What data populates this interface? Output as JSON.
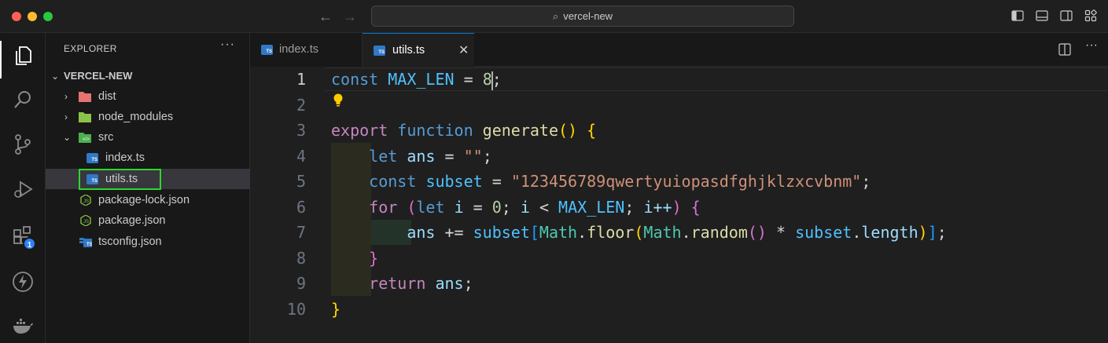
{
  "window": {
    "search_text": "vercel-new"
  },
  "sidebar": {
    "header": "EXPLORER",
    "more": "···",
    "root": "VERCEL-NEW",
    "items": [
      {
        "label": "dist",
        "icon": "folder-dist-icon"
      },
      {
        "label": "node_modules",
        "icon": "folder-node-icon"
      },
      {
        "label": "src",
        "icon": "folder-src-icon"
      },
      {
        "label": "index.ts",
        "icon": "typescript-file-icon"
      },
      {
        "label": "utils.ts",
        "icon": "typescript-file-icon"
      },
      {
        "label": "package-lock.json",
        "icon": "npm-json-icon"
      },
      {
        "label": "package.json",
        "icon": "npm-json-icon"
      },
      {
        "label": "tsconfig.json",
        "icon": "tsconfig-icon"
      }
    ]
  },
  "activity": {
    "extensions_badge": "1"
  },
  "tabs": [
    {
      "label": "index.ts",
      "active": false
    },
    {
      "label": "utils.ts",
      "active": true,
      "close": "✕"
    }
  ],
  "editor": {
    "line_numbers": [
      "1",
      "2",
      "3",
      "4",
      "5",
      "6",
      "7",
      "8",
      "9",
      "10"
    ],
    "active_line": 1,
    "tokens": {
      "const": "const",
      "max_len": "MAX_LEN",
      "eq": " = ",
      "eight": "8",
      "semi": ";",
      "export": "export",
      "function": "function",
      "generate": "generate",
      "let": "let",
      "ans": "ans",
      "empty_str": "\"\"",
      "subset": "subset",
      "subset_str": "\"123456789qwertyuiopasdfghjklzxcvbnm\"",
      "for": "for",
      "i": "i",
      "zero": "0",
      "lt": " < ",
      "inc": "i++",
      "plus_eq": " += ",
      "math": "Math",
      "floor": "floor",
      "random": "random",
      "times": " * ",
      "length": "length",
      "return": "return"
    }
  },
  "colors": {
    "accent": "#0078d4",
    "highlight_box": "#2fd62f",
    "badge": "#2f81f7",
    "ts": "#3178c6"
  }
}
